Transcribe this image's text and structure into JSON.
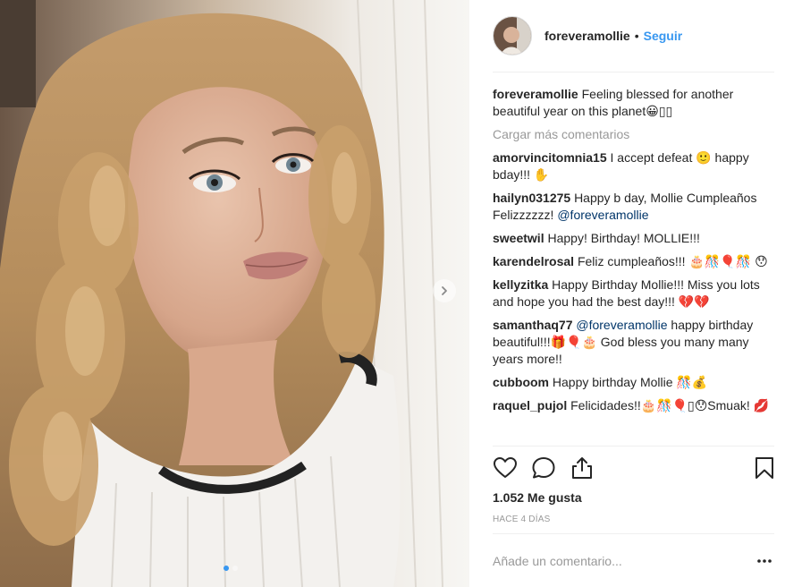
{
  "post": {
    "username": "foreveramollie",
    "separator": "•",
    "follow_label": "Seguir",
    "caption": {
      "user": "foreveramollie",
      "text": "Feeling blessed for another beautiful year on this planet😀▯▯"
    },
    "load_more_label": "Cargar más comentarios",
    "comments": [
      {
        "user": "amorvincitomnia15",
        "text": "I accept defeat 🙂 happy bday!!! ✋"
      },
      {
        "user": "hailyn031275",
        "text": "Happy b day, Mollie Cumpleaños Felizzzzzz!",
        "mention": "@foreveramollie"
      },
      {
        "user": "sweetwil",
        "text": "Happy! Birthday! MOLLIE!!!"
      },
      {
        "user": "karendelrosal",
        "text": "Feliz cumpleaños!!! 🎂🎊🎈🎊 😯"
      },
      {
        "user": "kellyzitka",
        "text": "Happy Birthday Mollie!!! Miss you lots and hope you had the best day!!! 💔💔"
      },
      {
        "user": "samanthaq77",
        "mention": "@foreveramollie",
        "text": "happy birthday beautiful!!!🎁🎈🎂 God bless you many many years more!!"
      },
      {
        "user": "cubboom",
        "text": "Happy birthday Mollie 🎊💰"
      },
      {
        "user": "raquel_pujol",
        "text": "Felicidades!!🎂🎊🎈▯😯Smuak! 💋"
      }
    ],
    "likes_label": "1.052 Me gusta",
    "time_label": "HACE 4 DÍAS",
    "comment_placeholder": "Añade un comentario...",
    "carousel": {
      "total": 2,
      "active": 1
    },
    "colors": {
      "accent": "#3897f0",
      "text": "#262626",
      "muted": "#999999",
      "divider": "#efefef"
    },
    "icons": [
      "chevron-right-icon",
      "heart-icon",
      "comment-icon",
      "share-icon",
      "bookmark-icon",
      "more-options-icon"
    ]
  }
}
